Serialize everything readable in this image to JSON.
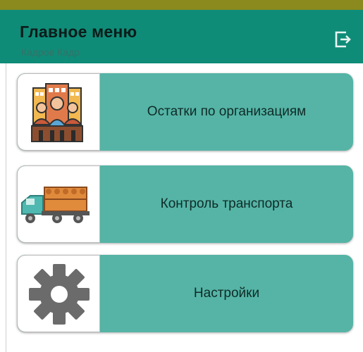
{
  "header": {
    "title": "Главное меню",
    "subtitle": "Кадров Кадр",
    "exit_icon": "exit-icon"
  },
  "menu": [
    {
      "label": "Остатки по организациям",
      "icon": "organizations-icon"
    },
    {
      "label": "Контроль транспорта",
      "icon": "timber-truck-icon"
    },
    {
      "label": "Настройки",
      "icon": "gear-icon"
    }
  ],
  "colors": {
    "header_bg": "#0f8c78",
    "button_bg": "#55b4a6",
    "top_stripe": "#8a8a1e"
  }
}
